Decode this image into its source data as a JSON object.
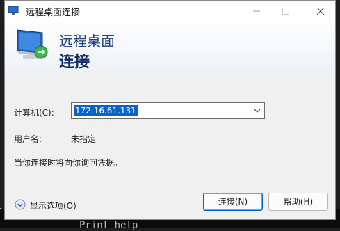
{
  "window": {
    "title": "远程桌面连接"
  },
  "banner": {
    "line1": "远程桌面",
    "line2": "连接"
  },
  "form": {
    "computer_label": "计算机(C):",
    "computer_value": "172.16.61.131",
    "user_label": "用户名:",
    "user_value": "未指定",
    "info": "当你连接时将向你询问凭据。"
  },
  "footer": {
    "options_label": "显示选项(O)",
    "connect_label": "连接(N)",
    "help_label": "帮助(H)"
  },
  "background": {
    "terminal_line1": "l",
    "terminal_line2": "Print help"
  }
}
